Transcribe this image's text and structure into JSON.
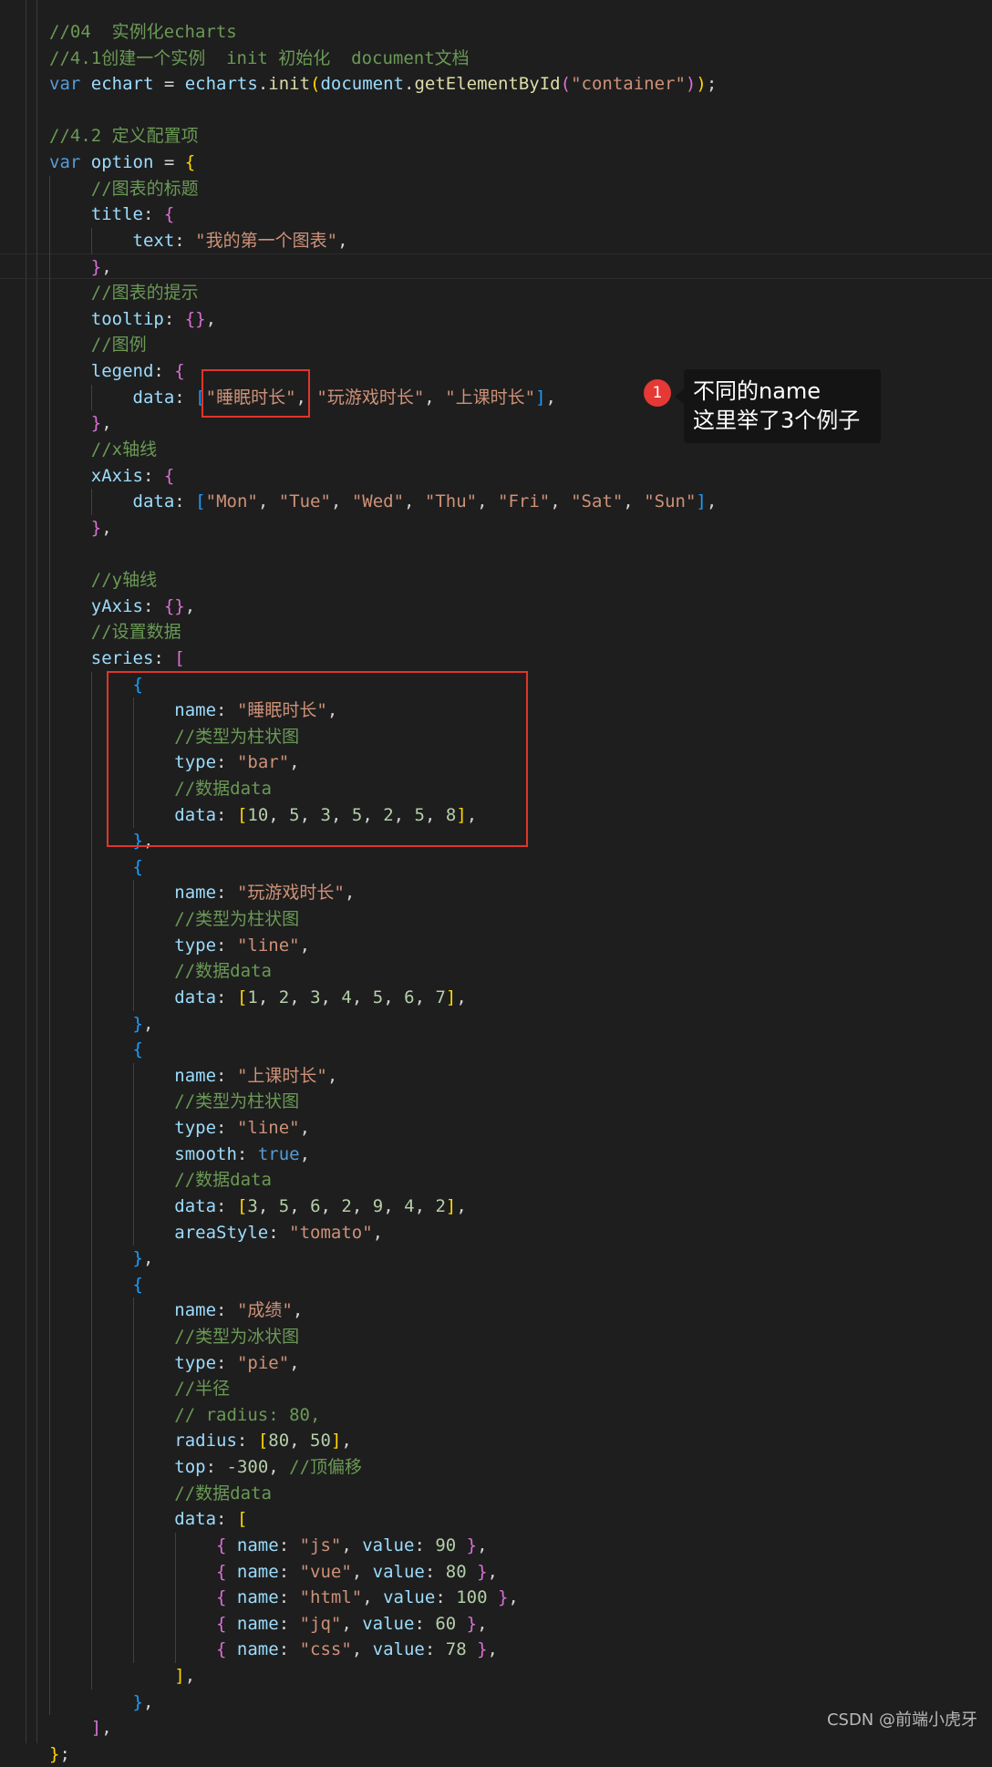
{
  "code_lines": [
    [
      [
        "tok-cmt",
        "//04  实例化echarts"
      ]
    ],
    [
      [
        "tok-cmt",
        "//4.1创建一个实例  init 初始化  document文档"
      ]
    ],
    [
      [
        "tok-kw",
        "var "
      ],
      [
        "tok-var",
        "echart"
      ],
      [
        "tok-op",
        " = "
      ],
      [
        "tok-var",
        "echarts"
      ],
      [
        "tok-op",
        "."
      ],
      [
        "tok-fn",
        "init"
      ],
      [
        "tok-b1",
        "("
      ],
      [
        "tok-var",
        "document"
      ],
      [
        "tok-op",
        "."
      ],
      [
        "tok-fn",
        "getElementById"
      ],
      [
        "tok-b2",
        "("
      ],
      [
        "tok-str",
        "\"container\""
      ],
      [
        "tok-b2",
        ")"
      ],
      [
        "tok-b1",
        ")"
      ],
      [
        "tok-op",
        ";"
      ]
    ],
    [],
    [
      [
        "tok-cmt",
        "//4.2 定义配置项"
      ]
    ],
    [
      [
        "tok-kw",
        "var "
      ],
      [
        "tok-var",
        "option"
      ],
      [
        "tok-op",
        " = "
      ],
      [
        "tok-b1",
        "{"
      ]
    ],
    [
      [
        "tok-op",
        "    "
      ],
      [
        "tok-cmt",
        "//图表的标题"
      ]
    ],
    [
      [
        "tok-op",
        "    "
      ],
      [
        "tok-var",
        "title"
      ],
      [
        "tok-op",
        ": "
      ],
      [
        "tok-b2",
        "{"
      ]
    ],
    [
      [
        "tok-op",
        "        "
      ],
      [
        "tok-var",
        "text"
      ],
      [
        "tok-op",
        ": "
      ],
      [
        "tok-str",
        "\"我的第一个图表\""
      ],
      [
        "tok-op",
        ","
      ]
    ],
    [
      [
        "tok-op",
        "    "
      ],
      [
        "tok-b2",
        "}"
      ],
      [
        "tok-op",
        ","
      ]
    ],
    [
      [
        "tok-op",
        "    "
      ],
      [
        "tok-cmt",
        "//图表的提示"
      ]
    ],
    [
      [
        "tok-op",
        "    "
      ],
      [
        "tok-var",
        "tooltip"
      ],
      [
        "tok-op",
        ": "
      ],
      [
        "tok-b2",
        "{}"
      ],
      [
        "tok-op",
        ","
      ]
    ],
    [
      [
        "tok-op",
        "    "
      ],
      [
        "tok-cmt",
        "//图例"
      ]
    ],
    [
      [
        "tok-op",
        "    "
      ],
      [
        "tok-var",
        "legend"
      ],
      [
        "tok-op",
        ": "
      ],
      [
        "tok-b2",
        "{"
      ]
    ],
    [
      [
        "tok-op",
        "        "
      ],
      [
        "tok-var",
        "data"
      ],
      [
        "tok-op",
        ": "
      ],
      [
        "tok-b3",
        "["
      ],
      [
        "tok-str",
        "\"睡眠时长\""
      ],
      [
        "tok-op",
        ", "
      ],
      [
        "tok-str",
        "\"玩游戏时长\""
      ],
      [
        "tok-op",
        ", "
      ],
      [
        "tok-str",
        "\"上课时长\""
      ],
      [
        "tok-b3",
        "]"
      ],
      [
        "tok-op",
        ","
      ]
    ],
    [
      [
        "tok-op",
        "    "
      ],
      [
        "tok-b2",
        "}"
      ],
      [
        "tok-op",
        ","
      ]
    ],
    [
      [
        "tok-op",
        "    "
      ],
      [
        "tok-cmt",
        "//x轴线"
      ]
    ],
    [
      [
        "tok-op",
        "    "
      ],
      [
        "tok-var",
        "xAxis"
      ],
      [
        "tok-op",
        ": "
      ],
      [
        "tok-b2",
        "{"
      ]
    ],
    [
      [
        "tok-op",
        "        "
      ],
      [
        "tok-var",
        "data"
      ],
      [
        "tok-op",
        ": "
      ],
      [
        "tok-b3",
        "["
      ],
      [
        "tok-str",
        "\"Mon\""
      ],
      [
        "tok-op",
        ", "
      ],
      [
        "tok-str",
        "\"Tue\""
      ],
      [
        "tok-op",
        ", "
      ],
      [
        "tok-str",
        "\"Wed\""
      ],
      [
        "tok-op",
        ", "
      ],
      [
        "tok-str",
        "\"Thu\""
      ],
      [
        "tok-op",
        ", "
      ],
      [
        "tok-str",
        "\"Fri\""
      ],
      [
        "tok-op",
        ", "
      ],
      [
        "tok-str",
        "\"Sat\""
      ],
      [
        "tok-op",
        ", "
      ],
      [
        "tok-str",
        "\"Sun\""
      ],
      [
        "tok-b3",
        "]"
      ],
      [
        "tok-op",
        ","
      ]
    ],
    [
      [
        "tok-op",
        "    "
      ],
      [
        "tok-b2",
        "}"
      ],
      [
        "tok-op",
        ","
      ]
    ],
    [],
    [
      [
        "tok-op",
        "    "
      ],
      [
        "tok-cmt",
        "//y轴线"
      ]
    ],
    [
      [
        "tok-op",
        "    "
      ],
      [
        "tok-var",
        "yAxis"
      ],
      [
        "tok-op",
        ": "
      ],
      [
        "tok-b2",
        "{}"
      ],
      [
        "tok-op",
        ","
      ]
    ],
    [
      [
        "tok-op",
        "    "
      ],
      [
        "tok-cmt",
        "//设置数据"
      ]
    ],
    [
      [
        "tok-op",
        "    "
      ],
      [
        "tok-var",
        "series"
      ],
      [
        "tok-op",
        ": "
      ],
      [
        "tok-b2",
        "["
      ]
    ],
    [
      [
        "tok-op",
        "        "
      ],
      [
        "tok-b3",
        "{"
      ]
    ],
    [
      [
        "tok-op",
        "            "
      ],
      [
        "tok-var",
        "name"
      ],
      [
        "tok-op",
        ": "
      ],
      [
        "tok-str",
        "\"睡眠时长\""
      ],
      [
        "tok-op",
        ","
      ]
    ],
    [
      [
        "tok-op",
        "            "
      ],
      [
        "tok-cmt",
        "//类型为柱状图"
      ]
    ],
    [
      [
        "tok-op",
        "            "
      ],
      [
        "tok-var",
        "type"
      ],
      [
        "tok-op",
        ": "
      ],
      [
        "tok-str",
        "\"bar\""
      ],
      [
        "tok-op",
        ","
      ]
    ],
    [
      [
        "tok-op",
        "            "
      ],
      [
        "tok-cmt",
        "//数据data"
      ]
    ],
    [
      [
        "tok-op",
        "            "
      ],
      [
        "tok-var",
        "data"
      ],
      [
        "tok-op",
        ": "
      ],
      [
        "tok-b1",
        "["
      ],
      [
        "tok-num",
        "10"
      ],
      [
        "tok-op",
        ", "
      ],
      [
        "tok-num",
        "5"
      ],
      [
        "tok-op",
        ", "
      ],
      [
        "tok-num",
        "3"
      ],
      [
        "tok-op",
        ", "
      ],
      [
        "tok-num",
        "5"
      ],
      [
        "tok-op",
        ", "
      ],
      [
        "tok-num",
        "2"
      ],
      [
        "tok-op",
        ", "
      ],
      [
        "tok-num",
        "5"
      ],
      [
        "tok-op",
        ", "
      ],
      [
        "tok-num",
        "8"
      ],
      [
        "tok-b1",
        "]"
      ],
      [
        "tok-op",
        ","
      ]
    ],
    [
      [
        "tok-op",
        "        "
      ],
      [
        "tok-b3",
        "}"
      ],
      [
        "tok-op",
        ","
      ]
    ],
    [
      [
        "tok-op",
        "        "
      ],
      [
        "tok-b3",
        "{"
      ]
    ],
    [
      [
        "tok-op",
        "            "
      ],
      [
        "tok-var",
        "name"
      ],
      [
        "tok-op",
        ": "
      ],
      [
        "tok-str",
        "\"玩游戏时长\""
      ],
      [
        "tok-op",
        ","
      ]
    ],
    [
      [
        "tok-op",
        "            "
      ],
      [
        "tok-cmt",
        "//类型为柱状图"
      ]
    ],
    [
      [
        "tok-op",
        "            "
      ],
      [
        "tok-var",
        "type"
      ],
      [
        "tok-op",
        ": "
      ],
      [
        "tok-str",
        "\"line\""
      ],
      [
        "tok-op",
        ","
      ]
    ],
    [
      [
        "tok-op",
        "            "
      ],
      [
        "tok-cmt",
        "//数据data"
      ]
    ],
    [
      [
        "tok-op",
        "            "
      ],
      [
        "tok-var",
        "data"
      ],
      [
        "tok-op",
        ": "
      ],
      [
        "tok-b1",
        "["
      ],
      [
        "tok-num",
        "1"
      ],
      [
        "tok-op",
        ", "
      ],
      [
        "tok-num",
        "2"
      ],
      [
        "tok-op",
        ", "
      ],
      [
        "tok-num",
        "3"
      ],
      [
        "tok-op",
        ", "
      ],
      [
        "tok-num",
        "4"
      ],
      [
        "tok-op",
        ", "
      ],
      [
        "tok-num",
        "5"
      ],
      [
        "tok-op",
        ", "
      ],
      [
        "tok-num",
        "6"
      ],
      [
        "tok-op",
        ", "
      ],
      [
        "tok-num",
        "7"
      ],
      [
        "tok-b1",
        "]"
      ],
      [
        "tok-op",
        ","
      ]
    ],
    [
      [
        "tok-op",
        "        "
      ],
      [
        "tok-b3",
        "}"
      ],
      [
        "tok-op",
        ","
      ]
    ],
    [
      [
        "tok-op",
        "        "
      ],
      [
        "tok-b3",
        "{"
      ]
    ],
    [
      [
        "tok-op",
        "            "
      ],
      [
        "tok-var",
        "name"
      ],
      [
        "tok-op",
        ": "
      ],
      [
        "tok-str",
        "\"上课时长\""
      ],
      [
        "tok-op",
        ","
      ]
    ],
    [
      [
        "tok-op",
        "            "
      ],
      [
        "tok-cmt",
        "//类型为柱状图"
      ]
    ],
    [
      [
        "tok-op",
        "            "
      ],
      [
        "tok-var",
        "type"
      ],
      [
        "tok-op",
        ": "
      ],
      [
        "tok-str",
        "\"line\""
      ],
      [
        "tok-op",
        ","
      ]
    ],
    [
      [
        "tok-op",
        "            "
      ],
      [
        "tok-var",
        "smooth"
      ],
      [
        "tok-op",
        ": "
      ],
      [
        "tok-kw",
        "true"
      ],
      [
        "tok-op",
        ","
      ]
    ],
    [
      [
        "tok-op",
        "            "
      ],
      [
        "tok-cmt",
        "//数据data"
      ]
    ],
    [
      [
        "tok-op",
        "            "
      ],
      [
        "tok-var",
        "data"
      ],
      [
        "tok-op",
        ": "
      ],
      [
        "tok-b1",
        "["
      ],
      [
        "tok-num",
        "3"
      ],
      [
        "tok-op",
        ", "
      ],
      [
        "tok-num",
        "5"
      ],
      [
        "tok-op",
        ", "
      ],
      [
        "tok-num",
        "6"
      ],
      [
        "tok-op",
        ", "
      ],
      [
        "tok-num",
        "2"
      ],
      [
        "tok-op",
        ", "
      ],
      [
        "tok-num",
        "9"
      ],
      [
        "tok-op",
        ", "
      ],
      [
        "tok-num",
        "4"
      ],
      [
        "tok-op",
        ", "
      ],
      [
        "tok-num",
        "2"
      ],
      [
        "tok-b1",
        "]"
      ],
      [
        "tok-op",
        ","
      ]
    ],
    [
      [
        "tok-op",
        "            "
      ],
      [
        "tok-var",
        "areaStyle"
      ],
      [
        "tok-op",
        ": "
      ],
      [
        "tok-str",
        "\"tomato\""
      ],
      [
        "tok-op",
        ","
      ]
    ],
    [
      [
        "tok-op",
        "        "
      ],
      [
        "tok-b3",
        "}"
      ],
      [
        "tok-op",
        ","
      ]
    ],
    [
      [
        "tok-op",
        "        "
      ],
      [
        "tok-b3",
        "{"
      ]
    ],
    [
      [
        "tok-op",
        "            "
      ],
      [
        "tok-var",
        "name"
      ],
      [
        "tok-op",
        ": "
      ],
      [
        "tok-str",
        "\"成绩\""
      ],
      [
        "tok-op",
        ","
      ]
    ],
    [
      [
        "tok-op",
        "            "
      ],
      [
        "tok-cmt",
        "//类型为冰状图"
      ]
    ],
    [
      [
        "tok-op",
        "            "
      ],
      [
        "tok-var",
        "type"
      ],
      [
        "tok-op",
        ": "
      ],
      [
        "tok-str",
        "\"pie\""
      ],
      [
        "tok-op",
        ","
      ]
    ],
    [
      [
        "tok-op",
        "            "
      ],
      [
        "tok-cmt",
        "//半径"
      ]
    ],
    [
      [
        "tok-op",
        "            "
      ],
      [
        "tok-cmt",
        "// radius: 80,"
      ]
    ],
    [
      [
        "tok-op",
        "            "
      ],
      [
        "tok-var",
        "radius"
      ],
      [
        "tok-op",
        ": "
      ],
      [
        "tok-b1",
        "["
      ],
      [
        "tok-num",
        "80"
      ],
      [
        "tok-op",
        ", "
      ],
      [
        "tok-num",
        "50"
      ],
      [
        "tok-b1",
        "]"
      ],
      [
        "tok-op",
        ","
      ]
    ],
    [
      [
        "tok-op",
        "            "
      ],
      [
        "tok-var",
        "top"
      ],
      [
        "tok-op",
        ": "
      ],
      [
        "tok-num",
        "-300"
      ],
      [
        "tok-op",
        ", "
      ],
      [
        "tok-cmt",
        "//顶偏移"
      ]
    ],
    [
      [
        "tok-op",
        "            "
      ],
      [
        "tok-cmt",
        "//数据data"
      ]
    ],
    [
      [
        "tok-op",
        "            "
      ],
      [
        "tok-var",
        "data"
      ],
      [
        "tok-op",
        ": "
      ],
      [
        "tok-b1",
        "["
      ]
    ],
    [
      [
        "tok-op",
        "                "
      ],
      [
        "tok-b2",
        "{ "
      ],
      [
        "tok-var",
        "name"
      ],
      [
        "tok-op",
        ": "
      ],
      [
        "tok-str",
        "\"js\""
      ],
      [
        "tok-op",
        ", "
      ],
      [
        "tok-var",
        "value"
      ],
      [
        "tok-op",
        ": "
      ],
      [
        "tok-num",
        "90"
      ],
      [
        "tok-b2",
        " }"
      ],
      [
        "tok-op",
        ","
      ]
    ],
    [
      [
        "tok-op",
        "                "
      ],
      [
        "tok-b2",
        "{ "
      ],
      [
        "tok-var",
        "name"
      ],
      [
        "tok-op",
        ": "
      ],
      [
        "tok-str",
        "\"vue\""
      ],
      [
        "tok-op",
        ", "
      ],
      [
        "tok-var",
        "value"
      ],
      [
        "tok-op",
        ": "
      ],
      [
        "tok-num",
        "80"
      ],
      [
        "tok-b2",
        " }"
      ],
      [
        "tok-op",
        ","
      ]
    ],
    [
      [
        "tok-op",
        "                "
      ],
      [
        "tok-b2",
        "{ "
      ],
      [
        "tok-var",
        "name"
      ],
      [
        "tok-op",
        ": "
      ],
      [
        "tok-str",
        "\"html\""
      ],
      [
        "tok-op",
        ", "
      ],
      [
        "tok-var",
        "value"
      ],
      [
        "tok-op",
        ": "
      ],
      [
        "tok-num",
        "100"
      ],
      [
        "tok-b2",
        " }"
      ],
      [
        "tok-op",
        ","
      ]
    ],
    [
      [
        "tok-op",
        "                "
      ],
      [
        "tok-b2",
        "{ "
      ],
      [
        "tok-var",
        "name"
      ],
      [
        "tok-op",
        ": "
      ],
      [
        "tok-str",
        "\"jq\""
      ],
      [
        "tok-op",
        ", "
      ],
      [
        "tok-var",
        "value"
      ],
      [
        "tok-op",
        ": "
      ],
      [
        "tok-num",
        "60"
      ],
      [
        "tok-b2",
        " }"
      ],
      [
        "tok-op",
        ","
      ]
    ],
    [
      [
        "tok-op",
        "                "
      ],
      [
        "tok-b2",
        "{ "
      ],
      [
        "tok-var",
        "name"
      ],
      [
        "tok-op",
        ": "
      ],
      [
        "tok-str",
        "\"css\""
      ],
      [
        "tok-op",
        ", "
      ],
      [
        "tok-var",
        "value"
      ],
      [
        "tok-op",
        ": "
      ],
      [
        "tok-num",
        "78"
      ],
      [
        "tok-b2",
        " }"
      ],
      [
        "tok-op",
        ","
      ]
    ],
    [
      [
        "tok-op",
        "            "
      ],
      [
        "tok-b1",
        "]"
      ],
      [
        "tok-op",
        ","
      ]
    ],
    [
      [
        "tok-op",
        "        "
      ],
      [
        "tok-b3",
        "}"
      ],
      [
        "tok-op",
        ","
      ]
    ],
    [
      [
        "tok-op",
        "    "
      ],
      [
        "tok-b2",
        "]"
      ],
      [
        "tok-op",
        ","
      ]
    ],
    [
      [
        "tok-b1",
        "}"
      ],
      [
        "tok-op",
        ";"
      ]
    ]
  ],
  "annotation": {
    "badge_number": "1",
    "line1": "不同的name",
    "line2": "这里举了3个例子"
  },
  "watermark": "CSDN @前端小虎牙"
}
